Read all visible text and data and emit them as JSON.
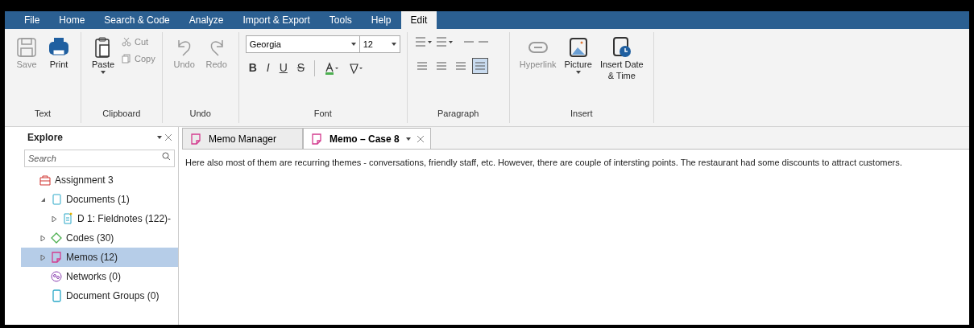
{
  "menu": [
    {
      "label": "File",
      "selected": false
    },
    {
      "label": "Home",
      "selected": false
    },
    {
      "label": "Search & Code",
      "selected": false
    },
    {
      "label": "Analyze",
      "selected": false
    },
    {
      "label": "Import & Export",
      "selected": false
    },
    {
      "label": "Tools",
      "selected": false
    },
    {
      "label": "Help",
      "selected": false
    },
    {
      "label": "Edit",
      "selected": true
    }
  ],
  "ribbon": {
    "groups": [
      {
        "kind": "large",
        "label": "Text",
        "buttons": [
          {
            "kind": "save",
            "label": "Save",
            "disabled": true
          },
          {
            "kind": "print",
            "label": "Print",
            "disabled": false
          }
        ]
      },
      {
        "kind": "clipboard",
        "label": "Clipboard",
        "buttons": [
          {
            "kind": "paste",
            "label": "Paste",
            "disabled": false,
            "dropdown": true
          }
        ],
        "small": [
          {
            "kind": "cut",
            "label": "Cut",
            "disabled": true
          },
          {
            "kind": "copy",
            "label": "Copy",
            "disabled": true
          }
        ]
      },
      {
        "kind": "large",
        "label": "Undo",
        "buttons": [
          {
            "kind": "undo",
            "label": "Undo",
            "disabled": true
          },
          {
            "kind": "redo",
            "label": "Redo",
            "disabled": true
          }
        ]
      },
      {
        "kind": "font",
        "label": "Font",
        "font_name": "Georgia",
        "font_size": "12",
        "styles": [
          "B",
          "I",
          "U",
          "S"
        ]
      },
      {
        "kind": "paragraph",
        "label": "Paragraph",
        "alignments": [
          {
            "selected": false
          },
          {
            "selected": false
          },
          {
            "selected": false
          },
          {
            "selected": true
          }
        ]
      },
      {
        "kind": "large",
        "label": "Insert",
        "buttons": [
          {
            "kind": "hyperlink",
            "label": "Hyperlink",
            "disabled": true
          },
          {
            "kind": "picture",
            "label": "Picture",
            "disabled": false,
            "dropdown": true
          },
          {
            "kind": "datetime",
            "label": "Insert Date & Time",
            "disabled": false
          }
        ]
      }
    ]
  },
  "explore": {
    "title": "Explore",
    "search": {
      "placeholder": "Search"
    },
    "tree": [
      {
        "kind": "project",
        "label": "Assignment 3",
        "selected": false,
        "children": [
          {
            "kind": "documents",
            "label": "Documents (1)",
            "expanded": true,
            "selected": false,
            "children": [
              {
                "kind": "document",
                "label": "D 1: Fieldnotes (122)-",
                "expanded": false,
                "selected": false
              }
            ]
          },
          {
            "kind": "codes",
            "label": "Codes (30)",
            "expanded": false,
            "selected": false
          },
          {
            "kind": "memos",
            "label": "Memos (12)",
            "expanded": false,
            "selected": true
          },
          {
            "kind": "networks",
            "label": "Networks (0)",
            "selected": false
          },
          {
            "kind": "groups",
            "label": "Document Groups (0)",
            "selected": false
          }
        ]
      }
    ]
  },
  "tabs": [
    {
      "label": "Memo Manager",
      "selected": false
    },
    {
      "label": "Memo – Case 8",
      "selected": true
    }
  ],
  "memo_text": "Here also most of them are recurring themes - conversations, friendly staff, etc. However, there are couple of intersting points. The restaurant had some discounts to attract customers."
}
